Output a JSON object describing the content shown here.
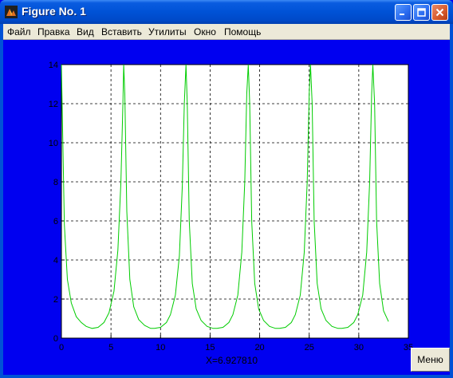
{
  "window": {
    "title": "Figure No. 1"
  },
  "menu": {
    "items": [
      "Файл",
      "Правка",
      "Вид",
      "Вставить",
      "Утилиты",
      "Окно",
      "Помощь"
    ]
  },
  "status": {
    "readout": "X=6.927810"
  },
  "menu_button": {
    "label": "Меню"
  },
  "colors": {
    "background": "#0000f0",
    "plot_bg": "#ffffff",
    "line": "#00cc00",
    "grid": "#000000"
  },
  "chart_data": {
    "type": "line",
    "title": "",
    "xlabel": "",
    "ylabel": "",
    "xlim": [
      0,
      35
    ],
    "ylim": [
      0,
      14
    ],
    "xticks": [
      0,
      5,
      10,
      15,
      20,
      25,
      30,
      35
    ],
    "yticks": [
      0,
      2,
      4,
      6,
      8,
      10,
      12,
      14
    ],
    "grid": true,
    "series": [
      {
        "values_description_free": true,
        "x": [
          0,
          0.3,
          0.6,
          1.0,
          1.5,
          2.0,
          2.5,
          3.1,
          3.7,
          4.3,
          4.8,
          5.3,
          5.7,
          6.0,
          6.2,
          6.28,
          6.4,
          6.6,
          6.9,
          7.3,
          7.8,
          8.4,
          9.0,
          9.4,
          10.0,
          10.6,
          11.0,
          11.5,
          11.9,
          12.2,
          12.4,
          12.57,
          12.7,
          12.9,
          13.2,
          13.6,
          14.1,
          14.7,
          15.3,
          15.7,
          16.3,
          16.9,
          17.3,
          17.8,
          18.2,
          18.5,
          18.7,
          18.85,
          19.0,
          19.2,
          19.5,
          19.9,
          20.4,
          21.0,
          21.6,
          22.0,
          22.6,
          23.2,
          23.6,
          24.1,
          24.5,
          24.8,
          25.0,
          25.13,
          25.3,
          25.5,
          25.8,
          26.2,
          26.7,
          27.3,
          27.9,
          28.3,
          28.9,
          29.5,
          29.9,
          30.4,
          30.8,
          31.1,
          31.3,
          31.42,
          31.6,
          31.8,
          32.1,
          32.5,
          33.0
        ],
        "y": [
          14.0,
          5.8,
          3.0,
          1.8,
          1.1,
          0.8,
          0.6,
          0.5,
          0.55,
          0.8,
          1.3,
          2.4,
          4.5,
          8.0,
          12.0,
          14.0,
          12.5,
          6.5,
          3.0,
          1.6,
          0.95,
          0.65,
          0.5,
          0.5,
          0.55,
          0.8,
          1.2,
          2.2,
          4.2,
          7.8,
          12.0,
          14.0,
          12.0,
          6.0,
          2.8,
          1.5,
          0.9,
          0.6,
          0.5,
          0.5,
          0.55,
          0.8,
          1.2,
          2.2,
          4.4,
          8.0,
          12.5,
          14.0,
          12.0,
          6.0,
          2.8,
          1.5,
          0.9,
          0.6,
          0.5,
          0.5,
          0.55,
          0.8,
          1.2,
          2.2,
          4.4,
          8.0,
          12.5,
          14.0,
          12.0,
          6.0,
          2.8,
          1.5,
          0.9,
          0.6,
          0.5,
          0.5,
          0.55,
          0.8,
          1.2,
          2.2,
          4.4,
          8.0,
          12.5,
          14.0,
          12.0,
          6.0,
          2.8,
          1.4,
          0.85
        ]
      }
    ]
  }
}
